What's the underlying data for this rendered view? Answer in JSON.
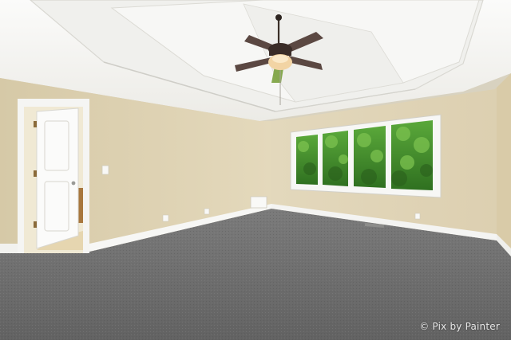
{
  "scene": {
    "description_tags": [
      "empty-bedroom",
      "tray-ceiling",
      "ceiling-fan",
      "carpet",
      "triple-window",
      "open-door"
    ],
    "colors": {
      "ceiling": "#f4f4f2",
      "wall_left": "#dccfae",
      "wall_back": "#e0d5b8",
      "carpet": "#6f6f6f",
      "trim": "#f7f7f5",
      "foliage": "#3f8a2a"
    }
  },
  "watermark": {
    "text": "© Pix by Painter"
  }
}
